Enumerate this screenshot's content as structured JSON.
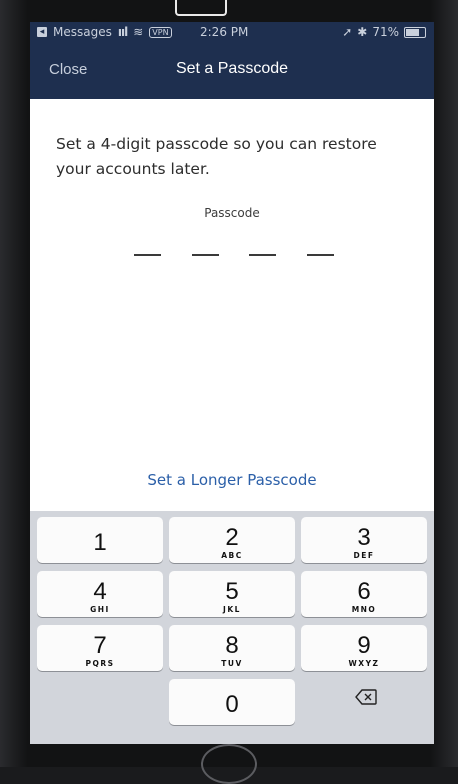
{
  "status_bar": {
    "back_app": "Messages",
    "time": "2:26 PM",
    "vpn": "VPN",
    "battery": "71%",
    "signal": "ııl"
  },
  "nav": {
    "close_label": "Close",
    "title": "Set a Passcode"
  },
  "content": {
    "instructions": "Set a 4-digit passcode so you can restore your accounts later.",
    "passcode_label": "Passcode",
    "longer_passcode_link": "Set a Longer Passcode"
  },
  "keypad": {
    "keys": [
      {
        "num": "1",
        "letters": ""
      },
      {
        "num": "2",
        "letters": "ABC"
      },
      {
        "num": "3",
        "letters": "DEF"
      },
      {
        "num": "4",
        "letters": "GHI"
      },
      {
        "num": "5",
        "letters": "JKL"
      },
      {
        "num": "6",
        "letters": "MNO"
      },
      {
        "num": "7",
        "letters": "PQRS"
      },
      {
        "num": "8",
        "letters": "TUV"
      },
      {
        "num": "9",
        "letters": "WXYZ"
      },
      {
        "num": "0",
        "letters": ""
      }
    ],
    "delete_icon": "backspace-icon"
  },
  "colors": {
    "nav_background": "#1e2f4f",
    "link": "#2b5fa8",
    "keypad_background": "#d2d5db"
  }
}
